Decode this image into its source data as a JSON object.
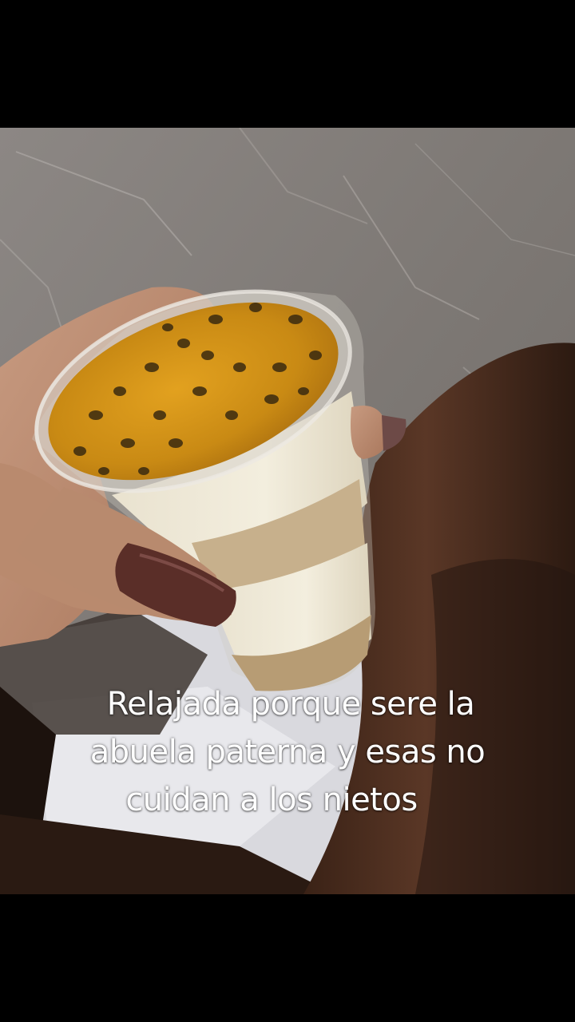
{
  "caption": {
    "line1": "Relajada porque sere la",
    "line2": "abuela paterna y esas no",
    "line3": "cuidan a los nietos"
  }
}
